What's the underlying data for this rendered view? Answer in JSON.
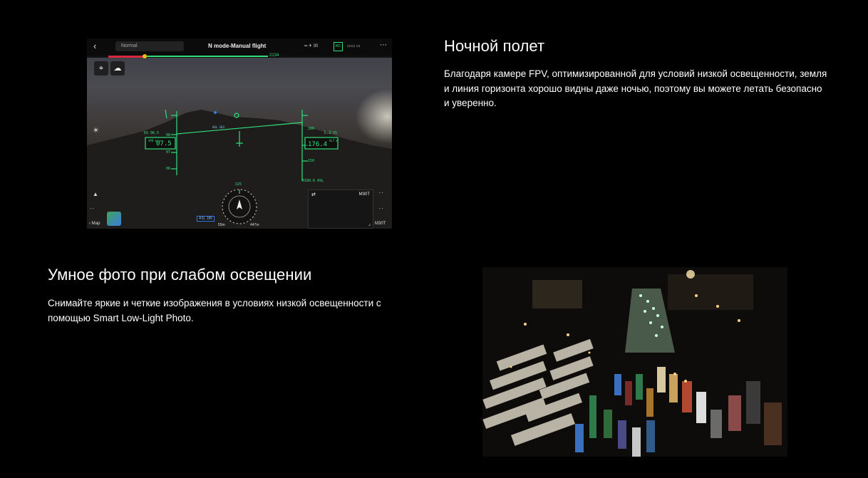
{
  "fpv": {
    "back_glyph": "‹",
    "mode": "Normal",
    "title": "N mode-Manual flight",
    "satellites": "30",
    "rc_badge": "RC",
    "more_glyph": "⋯",
    "distance_marker": "2134",
    "left_speed_label": "07.5",
    "left_speed_units": "SPD m/s",
    "left_scale": [
      "08",
      "07",
      "06"
    ],
    "left_top_small": "DS 06.5",
    "vs_value": "1.2",
    "vs_label": "VS",
    "alt_value": "176.4",
    "alt_units": "ALT m",
    "right_scale": [
      "200",
      "150"
    ],
    "asl_value": "0180.6 ASL",
    "asl_center": "ASL 163",
    "heading": "325",
    "asl_box": "ASL 185",
    "dist_a": "55m",
    "dist_b": "447m",
    "map_label": "Мар",
    "camera_label": "M30T",
    "camera_switch": "⇄",
    "camera_corner": "⌟",
    "dash": "- -"
  },
  "section1": {
    "heading": "Ночной полет",
    "text": "Благодаря камере FPV, оптимизированной для условий низкой освещенности, земля и линия горизонта хорошо видны даже ночью, поэтому вы можете летать безопасно и уверенно."
  },
  "section2": {
    "heading": "Умное фото при слабом освещении",
    "text": "Снимайте яркие и четкие изображения в условиях низкой освещенности с помощью Smart Low-Light Photo."
  },
  "colors": {
    "background": "#000000",
    "hud_green": "#2fe07a",
    "accent_red": "#d7263d"
  }
}
